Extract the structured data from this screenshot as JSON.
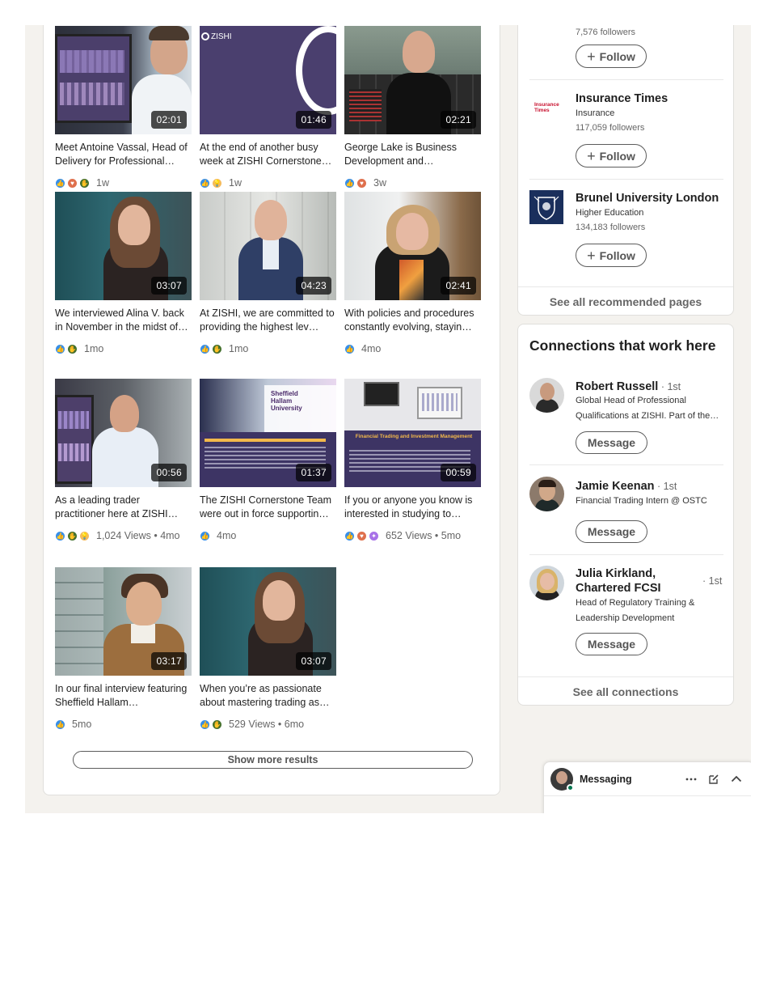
{
  "videos": [
    {
      "duration": "02:01",
      "title": "Meet Antoine Vassal, Head of Delivery for Professional…",
      "reactions": [
        "like",
        "love",
        "celebrate"
      ],
      "meta": "1w"
    },
    {
      "duration": "01:46",
      "title": "At the end of another busy week at ZISHI Cornerstone…",
      "reactions": [
        "like",
        "insight"
      ],
      "meta": "1w",
      "brand": "ZISHI"
    },
    {
      "duration": "02:21",
      "title": "George Lake is Business Development and…",
      "reactions": [
        "like",
        "love"
      ],
      "meta": "3w"
    },
    {
      "duration": "03:07",
      "title": "We interviewed Alina V. back in November in the midst of…",
      "reactions": [
        "like",
        "celebrate"
      ],
      "meta": "1mo"
    },
    {
      "duration": "04:23",
      "title": "At ZISHI, we are committed to providing the highest lev…",
      "reactions": [
        "like",
        "celebrate"
      ],
      "meta": "1mo"
    },
    {
      "duration": "02:41",
      "title": "With policies and procedures constantly evolving, stayin…",
      "reactions": [
        "like"
      ],
      "meta": "4mo"
    },
    {
      "duration": "00:56",
      "title": "As a leading trader practitioner here at ZISHI…",
      "reactions": [
        "like",
        "celebrate",
        "insight"
      ],
      "meta": "1,024 Views • 4mo"
    },
    {
      "duration": "01:37",
      "title": "The ZISHI Cornerstone Team were out in force supportin…",
      "reactions": [
        "like"
      ],
      "meta": "4mo",
      "brand": "Sheffield Hallam University"
    },
    {
      "duration": "00:59",
      "title": "If you or anyone you know is interested in studying to…",
      "reactions": [
        "like",
        "love",
        "support"
      ],
      "meta": "652 Views • 5mo",
      "brand": "Financial Trading and Investment Management"
    },
    {
      "duration": "03:17",
      "title": "In our final interview featuring Sheffield Hallam…",
      "reactions": [
        "like"
      ],
      "meta": "5mo"
    },
    {
      "duration": "03:07",
      "title": "When you’re as passionate about mastering trading as…",
      "reactions": [
        "like",
        "celebrate"
      ],
      "meta": "529 Views • 6mo"
    }
  ],
  "show_more": "Show more results",
  "pages": {
    "partial_followers": "7,576 followers",
    "items": [
      {
        "name": "Insurance Times",
        "sub": "Insurance",
        "followers": "117,059 followers",
        "logo_text": "Insurance Times"
      },
      {
        "name": "Brunel University London",
        "sub": "Higher Education",
        "followers": "134,183 followers"
      }
    ],
    "follow_label": "Follow",
    "follow_plus": "+",
    "see_all": "See all recommended pages"
  },
  "connections": {
    "title": "Connections that work here",
    "items": [
      {
        "name": "Robert Russell",
        "degree": " · 1st",
        "headline": "Global Head of Professional Qualifications at ZISHI. Part of the…"
      },
      {
        "name": "Jamie Keenan",
        "degree": " · 1st",
        "headline": "Financial Trading Intern @ OSTC"
      },
      {
        "name_line1": "Julia Kirkland,",
        "name_line2": "Chartered FCSI",
        "degree": "· 1st",
        "headline": "Head of Regulatory Training & Leadership Development"
      }
    ],
    "message_label": "Message",
    "see_all": "See all connections"
  },
  "messaging": {
    "title": "Messaging"
  }
}
